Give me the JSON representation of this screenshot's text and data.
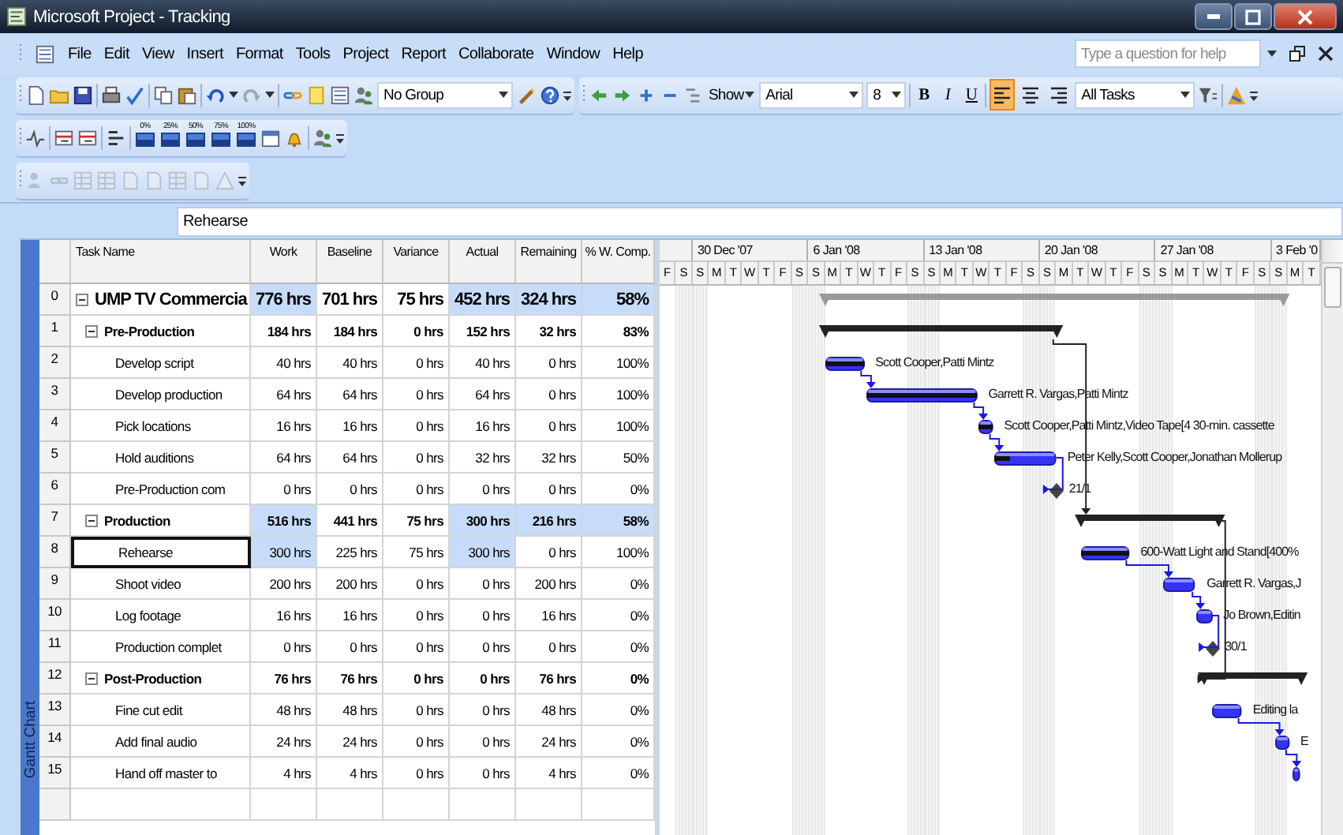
{
  "window": {
    "title": "Microsoft Project - Tracking"
  },
  "menu": [
    "File",
    "Edit",
    "View",
    "Insert",
    "Format",
    "Tools",
    "Project",
    "Report",
    "Collaborate",
    "Window",
    "Help"
  ],
  "help_search": {
    "placeholder": "Type a question for help"
  },
  "toolbar": {
    "group": "No Group",
    "show": "Show",
    "font": "Arial",
    "font_size": "8",
    "format_buttons": [
      "B",
      "I",
      "U"
    ],
    "alignment": [
      {
        "selected": true
      },
      {
        "selected": false
      },
      {
        "selected": false
      }
    ],
    "filter": "All Tasks"
  },
  "progress_buttons": [
    "0%",
    "25%",
    "50%",
    "75%",
    "100%"
  ],
  "analysis_toolbar": [
    {
      "disabled": true
    },
    {
      "disabled": true
    },
    {
      "disabled": true
    },
    {
      "disabled": true
    },
    {
      "disabled": true
    },
    {
      "disabled": true
    },
    {
      "disabled": true
    },
    {
      "disabled": true
    },
    {
      "disabled": true
    }
  ],
  "entry_bar": {
    "value": "Rehearse"
  },
  "view_bar": {
    "label": "Gantt Chart"
  },
  "table": {
    "columns": [
      "Task Name",
      "Work",
      "Baseline",
      "Variance",
      "Actual",
      "Remaining",
      "% W. Comp."
    ],
    "tasks": [
      {
        "id": "0",
        "name": "UMP TV Commercia",
        "kind": "project",
        "expanded": true,
        "selected": false,
        "cells": [
          {
            "text": "776 hrs",
            "highlighted": true
          },
          {
            "text": "701 hrs",
            "highlighted": false
          },
          {
            "text": "75 hrs",
            "highlighted": false
          },
          {
            "text": "452 hrs",
            "highlighted": true
          },
          {
            "text": "324 hrs",
            "highlighted": true
          },
          {
            "text": "58%",
            "highlighted": true
          }
        ],
        "children": [
          {
            "id": "1",
            "name": "Pre-Production",
            "kind": "summary",
            "expanded": true,
            "selected": false,
            "cells": [
              {
                "text": "184 hrs",
                "highlighted": false
              },
              {
                "text": "184 hrs",
                "highlighted": false
              },
              {
                "text": "0 hrs",
                "highlighted": false
              },
              {
                "text": "152 hrs",
                "highlighted": false
              },
              {
                "text": "32 hrs",
                "highlighted": false
              },
              {
                "text": "83%",
                "highlighted": false
              }
            ],
            "children": [
              {
                "id": "2",
                "name": "Develop script",
                "kind": "task",
                "selected": false,
                "bar_label": "Scott Cooper,Patti Mintz",
                "cells": [
                  {
                    "text": "40 hrs",
                    "highlighted": false
                  },
                  {
                    "text": "40 hrs",
                    "highlighted": false
                  },
                  {
                    "text": "0 hrs",
                    "highlighted": false
                  },
                  {
                    "text": "40 hrs",
                    "highlighted": false
                  },
                  {
                    "text": "0 hrs",
                    "highlighted": false
                  },
                  {
                    "text": "100%",
                    "highlighted": false
                  }
                ]
              },
              {
                "id": "3",
                "name": "Develop production",
                "kind": "task",
                "selected": false,
                "bar_label": "Garrett R. Vargas,Patti Mintz",
                "cells": [
                  {
                    "text": "64 hrs",
                    "highlighted": false
                  },
                  {
                    "text": "64 hrs",
                    "highlighted": false
                  },
                  {
                    "text": "0 hrs",
                    "highlighted": false
                  },
                  {
                    "text": "64 hrs",
                    "highlighted": false
                  },
                  {
                    "text": "0 hrs",
                    "highlighted": false
                  },
                  {
                    "text": "100%",
                    "highlighted": false
                  }
                ]
              },
              {
                "id": "4",
                "name": "Pick locations",
                "kind": "task",
                "selected": false,
                "bar_label": "Scott Cooper,Patti Mintz,Video Tape[4 30-min. cassette",
                "cells": [
                  {
                    "text": "16 hrs",
                    "highlighted": false
                  },
                  {
                    "text": "16 hrs",
                    "highlighted": false
                  },
                  {
                    "text": "0 hrs",
                    "highlighted": false
                  },
                  {
                    "text": "16 hrs",
                    "highlighted": false
                  },
                  {
                    "text": "0 hrs",
                    "highlighted": false
                  },
                  {
                    "text": "100%",
                    "highlighted": false
                  }
                ]
              },
              {
                "id": "5",
                "name": "Hold auditions",
                "kind": "task",
                "selected": false,
                "bar_label": "Peter Kelly,Scott Cooper,Jonathan Mollerup",
                "cells": [
                  {
                    "text": "64 hrs",
                    "highlighted": false
                  },
                  {
                    "text": "64 hrs",
                    "highlighted": false
                  },
                  {
                    "text": "0 hrs",
                    "highlighted": false
                  },
                  {
                    "text": "32 hrs",
                    "highlighted": false
                  },
                  {
                    "text": "32 hrs",
                    "highlighted": false
                  },
                  {
                    "text": "50%",
                    "highlighted": false
                  }
                ]
              },
              {
                "id": "6",
                "name": "Pre-Production com",
                "kind": "milestone",
                "selected": false,
                "bar_label": "21/1",
                "cells": [
                  {
                    "text": "0 hrs",
                    "highlighted": false
                  },
                  {
                    "text": "0 hrs",
                    "highlighted": false
                  },
                  {
                    "text": "0 hrs",
                    "highlighted": false
                  },
                  {
                    "text": "0 hrs",
                    "highlighted": false
                  },
                  {
                    "text": "0 hrs",
                    "highlighted": false
                  },
                  {
                    "text": "0%",
                    "highlighted": false
                  }
                ]
              }
            ]
          },
          {
            "id": "7",
            "name": "Production",
            "kind": "summary",
            "expanded": true,
            "selected": false,
            "cells": [
              {
                "text": "516 hrs",
                "highlighted": true
              },
              {
                "text": "441 hrs",
                "highlighted": false
              },
              {
                "text": "75 hrs",
                "highlighted": false
              },
              {
                "text": "300 hrs",
                "highlighted": true
              },
              {
                "text": "216 hrs",
                "highlighted": true
              },
              {
                "text": "58%",
                "highlighted": true
              }
            ],
            "children": [
              {
                "id": "8",
                "name": "Rehearse",
                "kind": "task",
                "selected": true,
                "bar_label": "600-Watt Light and Stand[400%",
                "cells": [
                  {
                    "text": "300 hrs",
                    "highlighted": true
                  },
                  {
                    "text": "225 hrs",
                    "highlighted": false
                  },
                  {
                    "text": "75 hrs",
                    "highlighted": false
                  },
                  {
                    "text": "300 hrs",
                    "highlighted": true
                  },
                  {
                    "text": "0 hrs",
                    "highlighted": false
                  },
                  {
                    "text": "100%",
                    "highlighted": false
                  }
                ]
              },
              {
                "id": "9",
                "name": "Shoot video",
                "kind": "task",
                "selected": false,
                "bar_label": "Garrett R. Vargas,J",
                "cells": [
                  {
                    "text": "200 hrs",
                    "highlighted": false
                  },
                  {
                    "text": "200 hrs",
                    "highlighted": false
                  },
                  {
                    "text": "0 hrs",
                    "highlighted": false
                  },
                  {
                    "text": "0 hrs",
                    "highlighted": false
                  },
                  {
                    "text": "200 hrs",
                    "highlighted": false
                  },
                  {
                    "text": "0%",
                    "highlighted": false
                  }
                ]
              },
              {
                "id": "10",
                "name": "Log footage",
                "kind": "task",
                "selected": false,
                "bar_label": "Jo Brown,Editin",
                "cells": [
                  {
                    "text": "16 hrs",
                    "highlighted": false
                  },
                  {
                    "text": "16 hrs",
                    "highlighted": false
                  },
                  {
                    "text": "0 hrs",
                    "highlighted": false
                  },
                  {
                    "text": "0 hrs",
                    "highlighted": false
                  },
                  {
                    "text": "16 hrs",
                    "highlighted": false
                  },
                  {
                    "text": "0%",
                    "highlighted": false
                  }
                ]
              },
              {
                "id": "11",
                "name": "Production complet",
                "kind": "milestone",
                "selected": false,
                "bar_label": "30/1",
                "cells": [
                  {
                    "text": "0 hrs",
                    "highlighted": false
                  },
                  {
                    "text": "0 hrs",
                    "highlighted": false
                  },
                  {
                    "text": "0 hrs",
                    "highlighted": false
                  },
                  {
                    "text": "0 hrs",
                    "highlighted": false
                  },
                  {
                    "text": "0 hrs",
                    "highlighted": false
                  },
                  {
                    "text": "0%",
                    "highlighted": false
                  }
                ]
              }
            ]
          },
          {
            "id": "12",
            "name": "Post-Production",
            "kind": "summary",
            "expanded": true,
            "selected": false,
            "cells": [
              {
                "text": "76 hrs",
                "highlighted": false
              },
              {
                "text": "76 hrs",
                "highlighted": false
              },
              {
                "text": "0 hrs",
                "highlighted": false
              },
              {
                "text": "0 hrs",
                "highlighted": false
              },
              {
                "text": "76 hrs",
                "highlighted": false
              },
              {
                "text": "0%",
                "highlighted": false
              }
            ],
            "children": [
              {
                "id": "13",
                "name": "Fine cut edit",
                "kind": "task",
                "selected": false,
                "bar_label": "Editing la",
                "cells": [
                  {
                    "text": "48 hrs",
                    "highlighted": false
                  },
                  {
                    "text": "48 hrs",
                    "highlighted": false
                  },
                  {
                    "text": "0 hrs",
                    "highlighted": false
                  },
                  {
                    "text": "0 hrs",
                    "highlighted": false
                  },
                  {
                    "text": "48 hrs",
                    "highlighted": false
                  },
                  {
                    "text": "0%",
                    "highlighted": false
                  }
                ]
              },
              {
                "id": "14",
                "name": "Add final audio",
                "kind": "task",
                "selected": false,
                "bar_label": "E",
                "cells": [
                  {
                    "text": "24 hrs",
                    "highlighted": false
                  },
                  {
                    "text": "24 hrs",
                    "highlighted": false
                  },
                  {
                    "text": "0 hrs",
                    "highlighted": false
                  },
                  {
                    "text": "0 hrs",
                    "highlighted": false
                  },
                  {
                    "text": "24 hrs",
                    "highlighted": false
                  },
                  {
                    "text": "0%",
                    "highlighted": false
                  }
                ]
              },
              {
                "id": "15",
                "name": "Hand off master to",
                "kind": "task",
                "selected": false,
                "cells": [
                  {
                    "text": "4 hrs",
                    "highlighted": false
                  },
                  {
                    "text": "4 hrs",
                    "highlighted": false
                  },
                  {
                    "text": "0 hrs",
                    "highlighted": false
                  },
                  {
                    "text": "0 hrs",
                    "highlighted": false
                  },
                  {
                    "text": "4 hrs",
                    "highlighted": false
                  },
                  {
                    "text": "0%",
                    "highlighted": false
                  }
                ]
              }
            ]
          }
        ]
      }
    ]
  },
  "timescale": {
    "weeks": [
      "30 Dec '07",
      "6 Jan '08",
      "13 Jan '08",
      "20 Jan '08",
      "27 Jan '08",
      "3 Feb '0"
    ],
    "days": [
      "F",
      "S",
      "S",
      "M",
      "T",
      "W",
      "T",
      "F",
      "S",
      "S",
      "M",
      "T",
      "W",
      "T",
      "F",
      "S",
      "S",
      "M",
      "T",
      "W",
      "T",
      "F",
      "S",
      "S",
      "M",
      "T",
      "W",
      "T",
      "F",
      "S",
      "S",
      "M",
      "T",
      "W",
      "T",
      "F",
      "S",
      "S",
      "M",
      "T"
    ]
  }
}
